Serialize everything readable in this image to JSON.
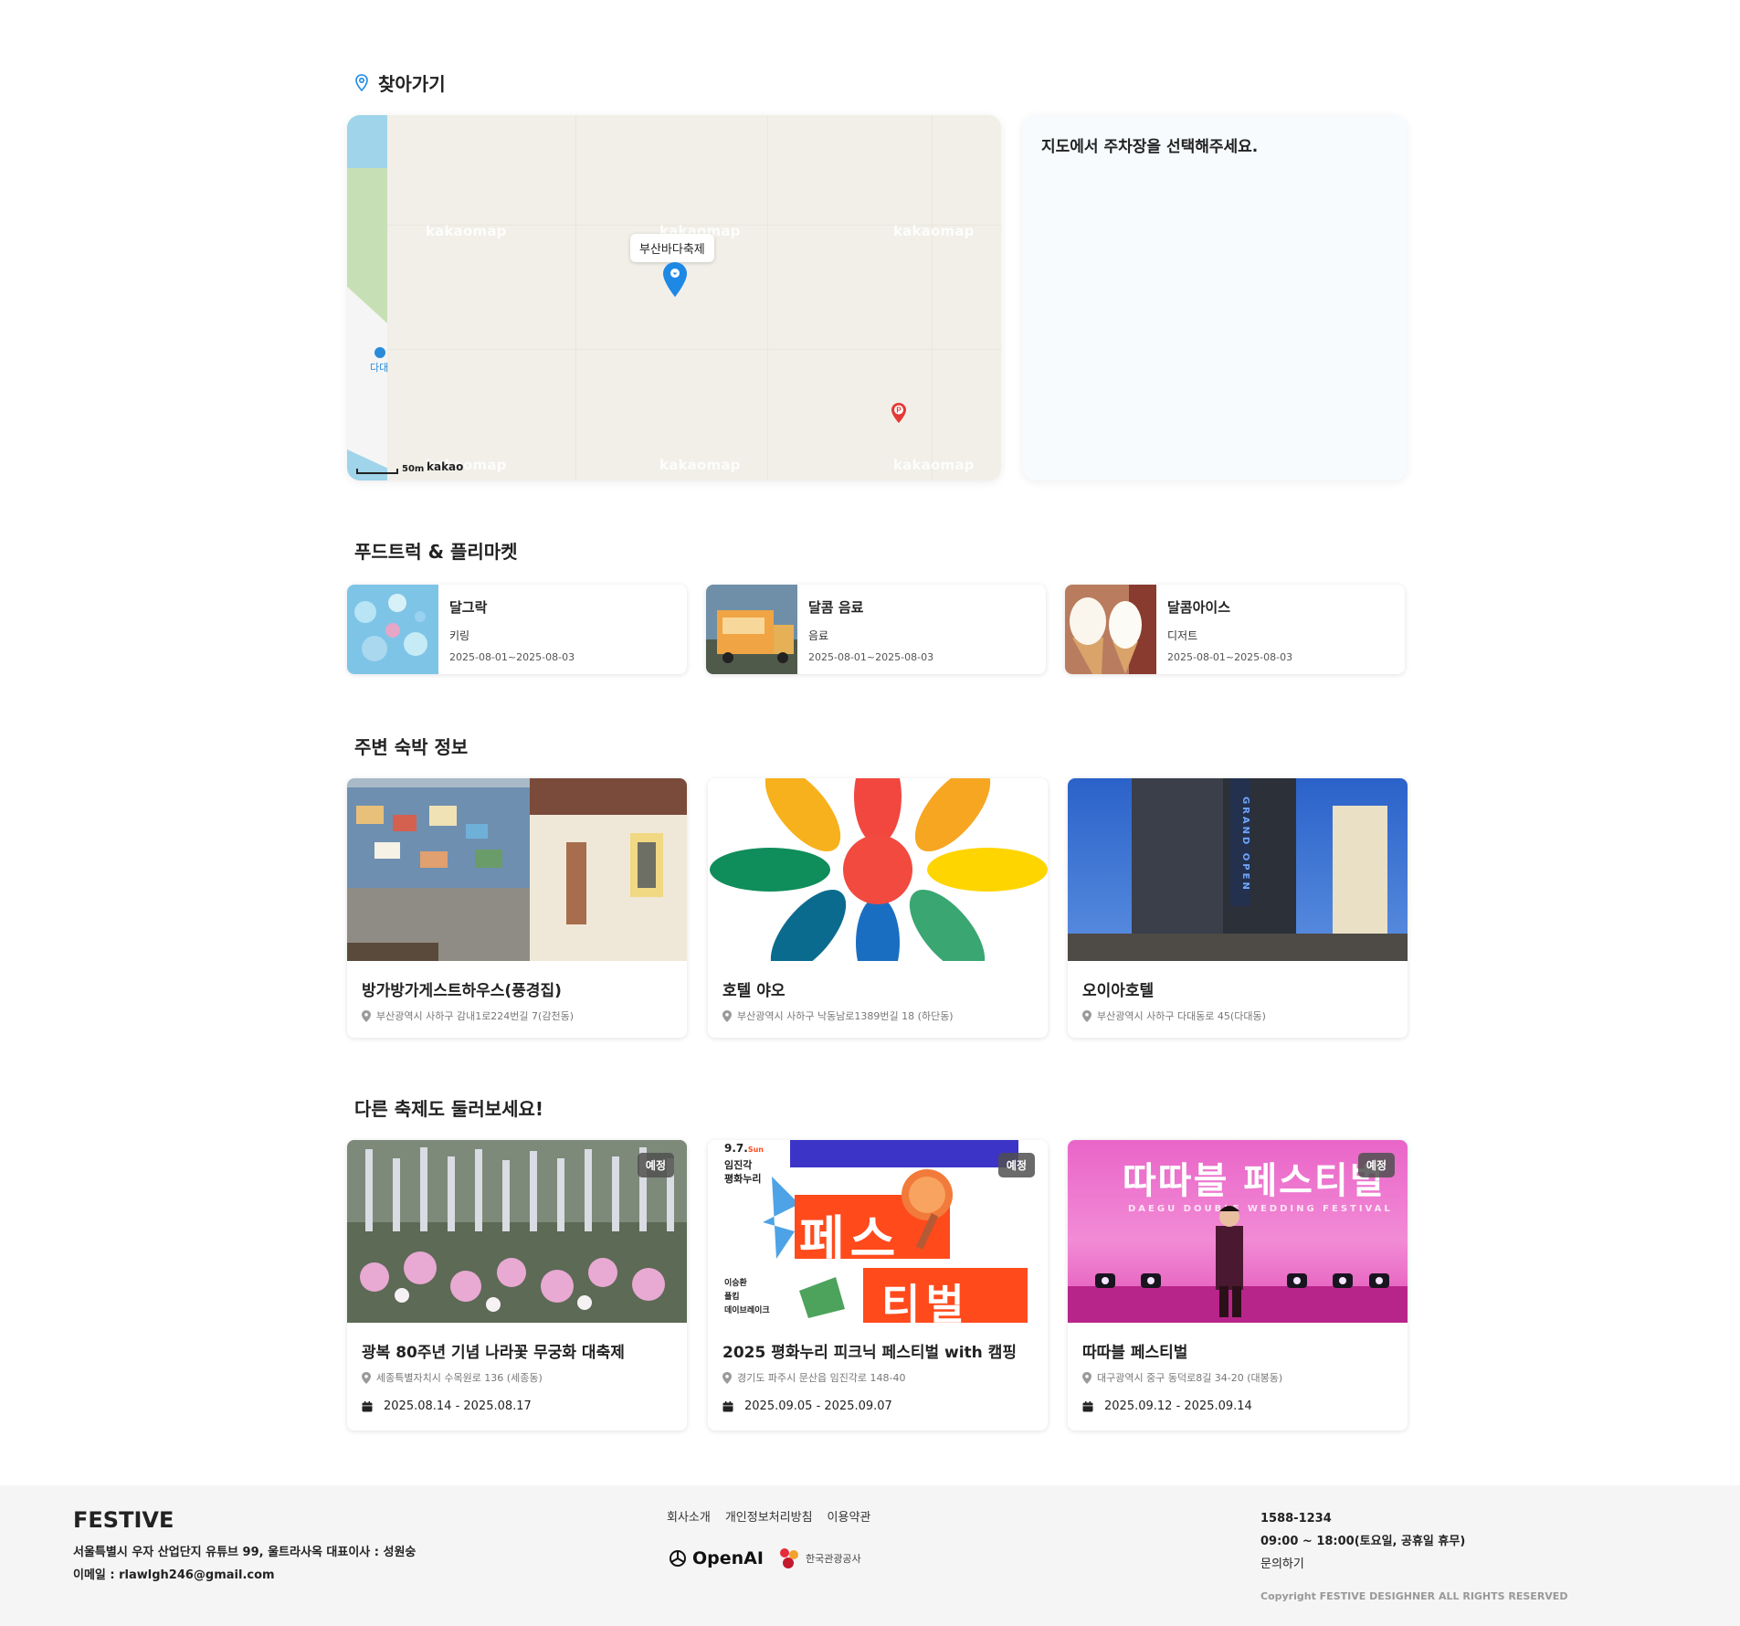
{
  "directions": {
    "title": "찾아가기",
    "map_marker_label": "부산바다축제",
    "watermark": "kakaomap",
    "scale_label": "50m",
    "map_brand": "kakao",
    "side_poi": "다대",
    "parking_prompt": "지도에서 주차장을 선택해주세요."
  },
  "food": {
    "title": "푸드트럭 & 플리마켓",
    "items": [
      {
        "name": "달그락",
        "category": "키링",
        "date": "2025-08-01~2025-08-03"
      },
      {
        "name": "달콤 음료",
        "category": "음료",
        "date": "2025-08-01~2025-08-03"
      },
      {
        "name": "달콤아이스",
        "category": "디저트",
        "date": "2025-08-01~2025-08-03"
      }
    ]
  },
  "lodging": {
    "title": "주변 숙박 정보",
    "items": [
      {
        "name": "방가방가게스트하우스(풍경집)",
        "address": "부산광역시 사하구 감내1로224번길 7(감천동)"
      },
      {
        "name": "호텔 야오",
        "address": "부산광역시 사하구 낙동남로1389번길 18 (하단동)"
      },
      {
        "name": "오이아호텔",
        "address": "부산광역시 사하구 다대동로 45(다대동)"
      }
    ],
    "hotel_sign": "GRAND OPEN"
  },
  "festivals": {
    "title": "다른 축제도 둘러보세요!",
    "items": [
      {
        "name": "광복 80주년 기념 나라꽃 무궁화 대축제",
        "address": "세종특별자치시 수목원로 136 (세종동)",
        "date": "2025.08.14 - 2025.08.17",
        "badge": "예정"
      },
      {
        "name": "2025 평화누리 피크닉 페스티벌 with 캠핑",
        "address": "경기도 파주시 문산읍 임진각로 148-40",
        "date": "2025.09.05 - 2025.09.07",
        "badge": "예정"
      },
      {
        "name": "따따블 페스티벌",
        "address": "대구광역시 중구 동덕로8길 34-20 (대봉동)",
        "date": "2025.09.12 - 2025.09.14",
        "badge": "예정"
      }
    ],
    "poster2": {
      "date": "9.7.",
      "day": "Sun",
      "line1": "임진각",
      "line2": "평화누리",
      "big1": "페스",
      "big2": "티벌",
      "artists": [
        "이승환",
        "폴킴",
        "데이브레이크"
      ]
    },
    "poster3": {
      "title": "따따블 페스티벌",
      "subtitle": "DAEGU DOUBLE WEDDING FESTIVAL"
    }
  },
  "footer": {
    "brand": "FESTIVE",
    "address": "서울특별시 우자 산업단지 유튜브 99, 울트라사옥 대표이사 : 성원숭",
    "email": "이메일 : rlawlgh246@gmail.com",
    "links": [
      "회사소개",
      "개인정보처리방침",
      "이용약관"
    ],
    "partner1": "OpenAI",
    "partner2": "한국관광공사",
    "phone": "1588-1234",
    "hours": "09:00 ~ 18:00(토요일, 공휴일 휴무)",
    "inquiry": "문의하기",
    "copyright": "Copyright FESTIVE DESIGHNER ALL RIGHTS RESERVED"
  },
  "colors": {
    "accent": "#1e88e5",
    "parking": "#e53935",
    "badge_bg": "#555555",
    "footer_bg": "#f5f5f5"
  }
}
